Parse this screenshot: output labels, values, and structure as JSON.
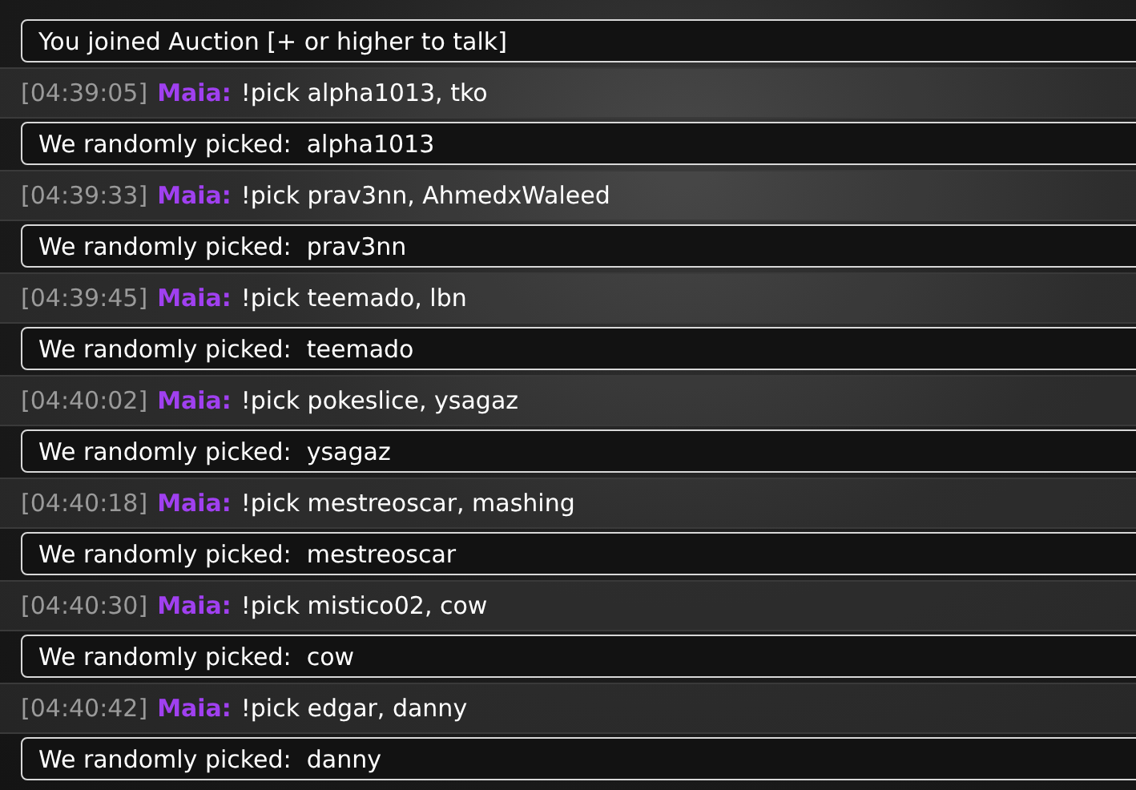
{
  "messages": [
    {
      "kind": "notice",
      "text": "You joined Auction [+ or higher to talk]"
    },
    {
      "kind": "chat",
      "time": "[04:39:05]",
      "user": "Maia:",
      "text": "!pick alpha1013, tko"
    },
    {
      "kind": "notice",
      "text": "We randomly picked:  alpha1013"
    },
    {
      "kind": "chat",
      "time": "[04:39:33]",
      "user": "Maia:",
      "text": "!pick prav3nn, AhmedxWaleed"
    },
    {
      "kind": "notice",
      "text": "We randomly picked:  prav3nn"
    },
    {
      "kind": "chat",
      "time": "[04:39:45]",
      "user": "Maia:",
      "text": "!pick teemado, lbn"
    },
    {
      "kind": "notice",
      "text": "We randomly picked:  teemado"
    },
    {
      "kind": "chat",
      "time": "[04:40:02]",
      "user": "Maia:",
      "text": "!pick pokeslice, ysagaz"
    },
    {
      "kind": "notice",
      "text": "We randomly picked:  ysagaz"
    },
    {
      "kind": "chat",
      "time": "[04:40:18]",
      "user": "Maia:",
      "text": "!pick mestreoscar, mashing"
    },
    {
      "kind": "notice",
      "text": "We randomly picked:  mestreoscar"
    },
    {
      "kind": "chat",
      "time": "[04:40:30]",
      "user": "Maia:",
      "text": "!pick mistico02, cow"
    },
    {
      "kind": "notice",
      "text": "We randomly picked:  cow"
    },
    {
      "kind": "chat",
      "time": "[04:40:42]",
      "user": "Maia:",
      "text": "!pick edgar, danny"
    },
    {
      "kind": "notice",
      "text": "We randomly picked:  danny"
    }
  ]
}
